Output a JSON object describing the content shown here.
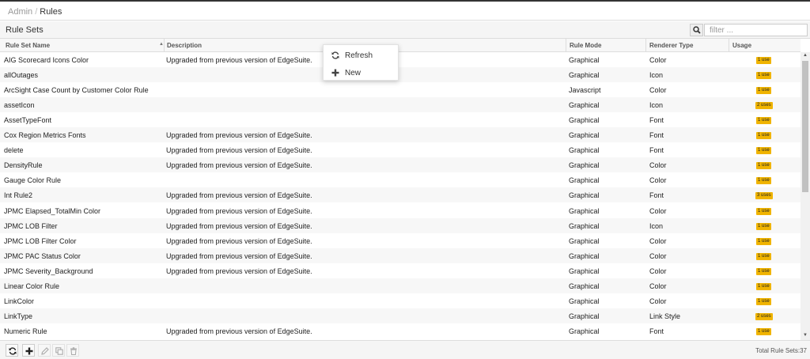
{
  "breadcrumb": {
    "parent": "Admin",
    "separator": "/",
    "current": "Rules"
  },
  "panel": {
    "title": "Rule Sets"
  },
  "search": {
    "placeholder": "filter ..."
  },
  "columns": {
    "name": "Rule Set Name",
    "description": "Description",
    "mode": "Rule Mode",
    "renderer": "Renderer Type",
    "usage": "Usage"
  },
  "rows": [
    {
      "name": "AIG Scorecard Icons Color",
      "description": "Upgraded from previous version of EdgeSuite.",
      "mode": "Graphical",
      "renderer": "Color",
      "usage": "1 use"
    },
    {
      "name": "allOutages",
      "description": "",
      "mode": "Graphical",
      "renderer": "Icon",
      "usage": "1 use"
    },
    {
      "name": "ArcSight Case Count by Customer Color Rule",
      "description": "",
      "mode": "Javascript",
      "renderer": "Color",
      "usage": "1 use"
    },
    {
      "name": "assetIcon",
      "description": "",
      "mode": "Graphical",
      "renderer": "Icon",
      "usage": "2 uses"
    },
    {
      "name": "AssetTypeFont",
      "description": "",
      "mode": "Graphical",
      "renderer": "Font",
      "usage": "1 use"
    },
    {
      "name": "Cox Region Metrics Fonts",
      "description": "Upgraded from previous version of EdgeSuite.",
      "mode": "Graphical",
      "renderer": "Font",
      "usage": "1 use"
    },
    {
      "name": "delete",
      "description": "Upgraded from previous version of EdgeSuite.",
      "mode": "Graphical",
      "renderer": "Font",
      "usage": "1 use"
    },
    {
      "name": "DensityRule",
      "description": "Upgraded from previous version of EdgeSuite.",
      "mode": "Graphical",
      "renderer": "Color",
      "usage": "1 use"
    },
    {
      "name": "Gauge Color Rule",
      "description": "",
      "mode": "Graphical",
      "renderer": "Color",
      "usage": "1 use"
    },
    {
      "name": "Int Rule2",
      "description": "Upgraded from previous version of EdgeSuite.",
      "mode": "Graphical",
      "renderer": "Font",
      "usage": "3 uses"
    },
    {
      "name": "JPMC Elapsed_TotalMin Color",
      "description": "Upgraded from previous version of EdgeSuite.",
      "mode": "Graphical",
      "renderer": "Color",
      "usage": "1 use"
    },
    {
      "name": "JPMC LOB Filter",
      "description": "Upgraded from previous version of EdgeSuite.",
      "mode": "Graphical",
      "renderer": "Icon",
      "usage": "1 use"
    },
    {
      "name": "JPMC LOB Filter Color",
      "description": "Upgraded from previous version of EdgeSuite.",
      "mode": "Graphical",
      "renderer": "Color",
      "usage": "1 use"
    },
    {
      "name": "JPMC PAC Status Color",
      "description": "Upgraded from previous version of EdgeSuite.",
      "mode": "Graphical",
      "renderer": "Color",
      "usage": "1 use"
    },
    {
      "name": "JPMC Severity_Background",
      "description": "Upgraded from previous version of EdgeSuite.",
      "mode": "Graphical",
      "renderer": "Color",
      "usage": "1 use"
    },
    {
      "name": "Linear Color Rule",
      "description": "",
      "mode": "Graphical",
      "renderer": "Color",
      "usage": "1 use"
    },
    {
      "name": "LinkColor",
      "description": "",
      "mode": "Graphical",
      "renderer": "Color",
      "usage": "1 use"
    },
    {
      "name": "LinkType",
      "description": "",
      "mode": "Graphical",
      "renderer": "Link Style",
      "usage": "2 uses"
    },
    {
      "name": "Numeric Rule",
      "description": "Upgraded from previous version of EdgeSuite.",
      "mode": "Graphical",
      "renderer": "Font",
      "usage": "1 use"
    }
  ],
  "context_menu": {
    "items": [
      {
        "label": "Refresh",
        "icon": "refresh-icon"
      },
      {
        "label": "New",
        "icon": "plus-icon"
      }
    ]
  },
  "footer": {
    "total_label": "Total Rule Sets:",
    "total_count": "37",
    "buttons": [
      "refresh-icon",
      "plus-icon",
      "pencil-icon",
      "copy-icon",
      "trash-icon"
    ]
  },
  "colors": {
    "usage_badge": "#f0b400",
    "header_bg": "#f5f5f5"
  }
}
